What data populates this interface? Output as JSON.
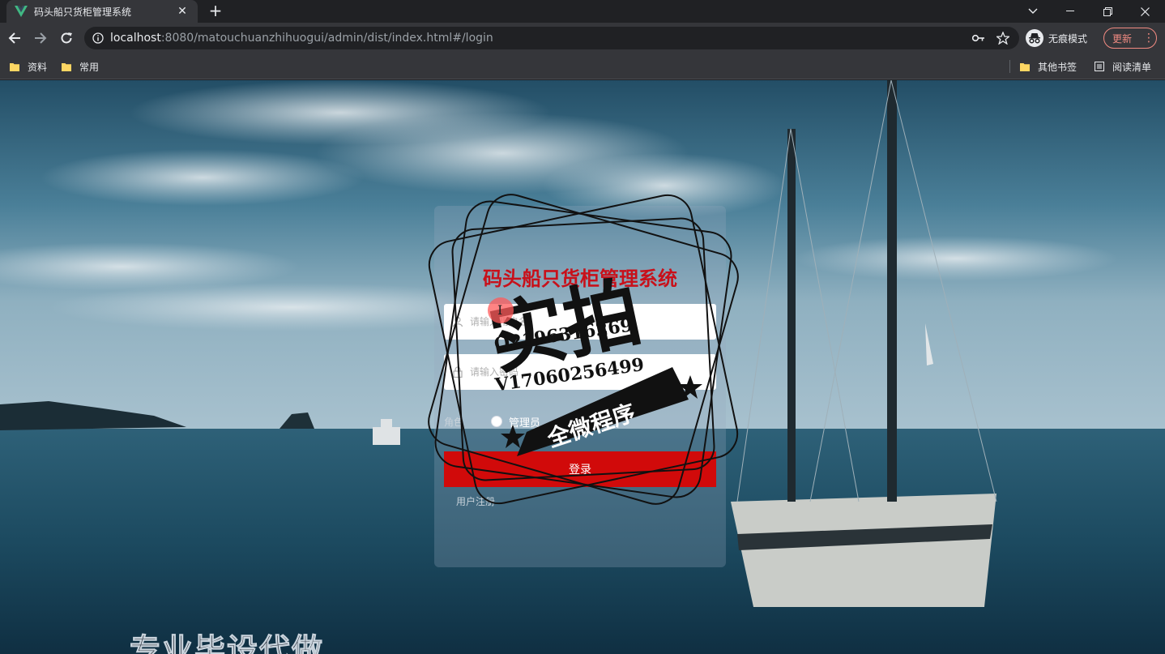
{
  "browser": {
    "tab": {
      "title": "码头船只货柜管理系统",
      "favicon": "vue-logo-icon",
      "close_glyph": "✕"
    },
    "new_tab_glyph": "+",
    "address": {
      "host": "localhost",
      "path": ":8080/matouchuanzhihuogui/admin/dist/index.html#/login"
    },
    "incognito_label": "无痕模式",
    "update_label": "更新",
    "update_menu_glyph": "⋮",
    "bookmarks": [
      {
        "label": "资料",
        "icon": "folder-icon"
      },
      {
        "label": "常用",
        "icon": "folder-icon"
      }
    ],
    "bookmarks_right": [
      {
        "label": "其他书签",
        "icon": "folder-icon"
      },
      {
        "label": "阅读清单",
        "icon": "reading-list-icon"
      }
    ]
  },
  "login": {
    "title": "码头船只货柜管理系统",
    "username_placeholder": "请输入用户名",
    "password_placeholder": "请输入密码",
    "role_label": "角色",
    "role_option": "管理员",
    "submit_label": "登录",
    "register_label": "用户注册"
  },
  "overlay": {
    "stamp_main": "实拍",
    "stamp_sub": "全微程序",
    "number_1": "Q2196316269",
    "number_2": "V17060256499",
    "banner": "专业毕设代做"
  },
  "colors": {
    "accent": "#d10a0a",
    "title": "#c8101a",
    "chrome": "#35363a"
  }
}
